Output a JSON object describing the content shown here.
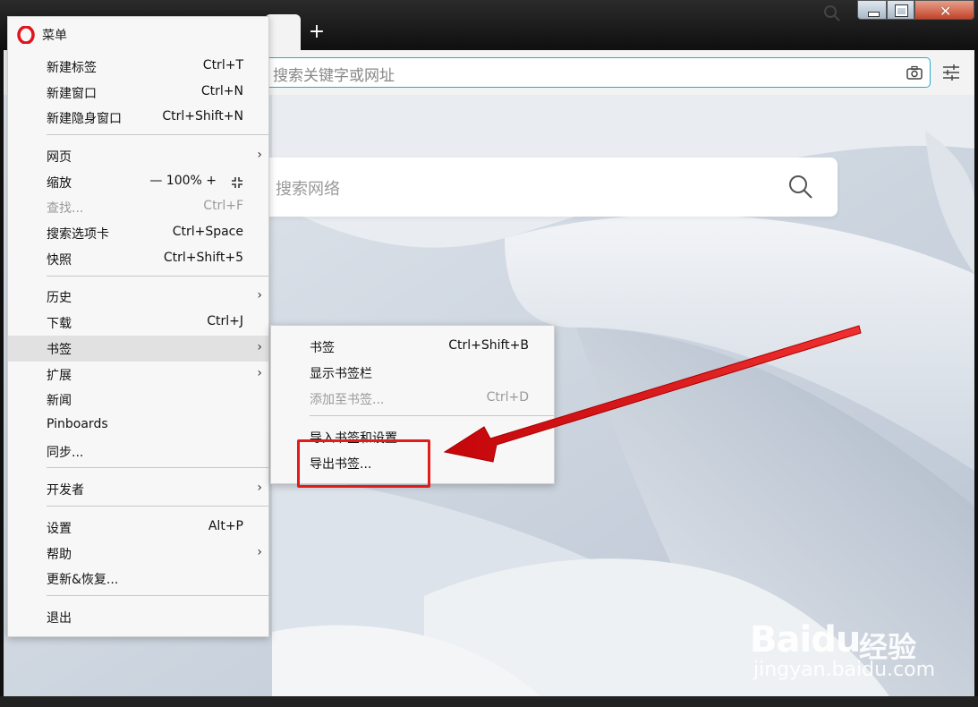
{
  "browser": {
    "new_tab_label": "+",
    "address_placeholder": "搜索关键字或网址",
    "search_placeholder": "搜索网络"
  },
  "menu": {
    "title": "菜单",
    "items": [
      {
        "label": "新建标签",
        "shortcut": "Ctrl+T"
      },
      {
        "label": "新建窗口",
        "shortcut": "Ctrl+N"
      },
      {
        "label": "新建隐身窗口",
        "shortcut": "Ctrl+Shift+N"
      },
      {
        "label": "网页",
        "shortcut": "",
        "arrow": "›"
      },
      {
        "label": "缩放",
        "zoom_minus": "—",
        "zoom_value": "100%",
        "zoom_plus": "+"
      },
      {
        "label": "查找...",
        "shortcut": "Ctrl+F"
      },
      {
        "label": "搜索选项卡",
        "shortcut": "Ctrl+Space"
      },
      {
        "label": "快照",
        "shortcut": "Ctrl+Shift+5"
      },
      {
        "label": "历史",
        "shortcut": "",
        "arrow": "›"
      },
      {
        "label": "下载",
        "shortcut": "Ctrl+J"
      },
      {
        "label": "书签",
        "shortcut": "",
        "arrow": "›"
      },
      {
        "label": "扩展",
        "shortcut": "",
        "arrow": "›"
      },
      {
        "label": "新闻",
        "shortcut": ""
      },
      {
        "label": "Pinboards",
        "shortcut": ""
      },
      {
        "label": "同步...",
        "shortcut": ""
      },
      {
        "label": "开发者",
        "shortcut": "",
        "arrow": "›"
      },
      {
        "label": "设置",
        "shortcut": "Alt+P"
      },
      {
        "label": "帮助",
        "shortcut": "",
        "arrow": "›"
      },
      {
        "label": "更新&恢复...",
        "shortcut": ""
      },
      {
        "label": "退出",
        "shortcut": ""
      }
    ]
  },
  "bookmarks_submenu": {
    "items": [
      {
        "label": "书签",
        "shortcut": "Ctrl+Shift+B"
      },
      {
        "label": "显示书签栏",
        "shortcut": ""
      },
      {
        "label": "添加至书签...",
        "shortcut": "Ctrl+D"
      },
      {
        "label": "导入书签和设置...",
        "shortcut": ""
      },
      {
        "label": "导出书签...",
        "shortcut": ""
      }
    ]
  },
  "watermark": {
    "brand": "Baidu",
    "brand_cn": "经验",
    "url": "jingyan.baidu.com"
  },
  "colors": {
    "highlight_box": "#e21b1b",
    "address_border": "#2fa8c7",
    "opera_red": "#e0141e"
  }
}
